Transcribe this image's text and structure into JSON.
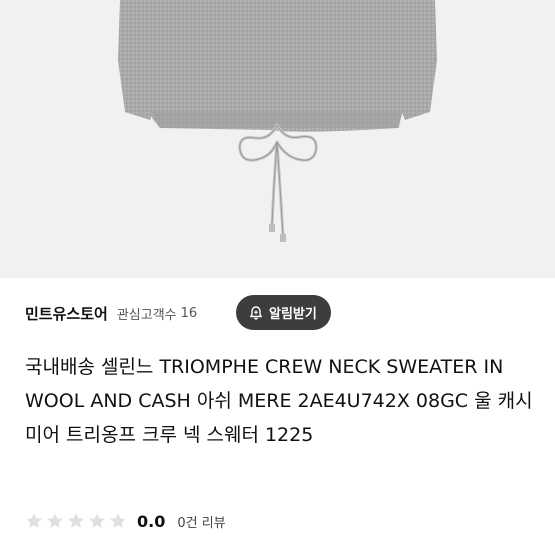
{
  "store": {
    "name": "민트유스토어",
    "followers_label": "관심고객수",
    "followers_count": "16",
    "alert_button_label": "알림받기",
    "alert_icon": "bell-plus-icon"
  },
  "product": {
    "title": "국내배송 셀린느 TRIOMPHE CREW NECK SWEATER IN WOOL AND CASH 아쉬 MERE 2AE4U742X 08GC 울 캐시미어 트리옹프 크루 넥 스웨터 1225"
  },
  "rating": {
    "score": "0.0",
    "filled_stars": 0,
    "max_stars": 5,
    "review_count_label": "0건 리뷰",
    "star_icon": "star-icon"
  },
  "colors": {
    "hero_background": "#f1f1f1",
    "sweater_gray": "#a9a9a9",
    "alert_button_bg": "#3d3d3d",
    "empty_star": "#e0e0e0"
  }
}
